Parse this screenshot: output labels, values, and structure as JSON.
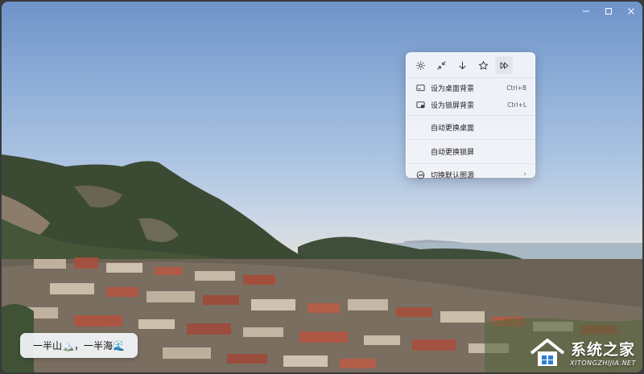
{
  "window_controls": {
    "minimize_icon": "minimize-icon",
    "maximize_icon": "maximize-icon",
    "close_icon": "close-icon"
  },
  "context_menu": {
    "toolbar": [
      {
        "name": "settings",
        "icon": "gear-icon"
      },
      {
        "name": "shrink",
        "icon": "collapse-icon"
      },
      {
        "name": "download",
        "icon": "download-icon"
      },
      {
        "name": "favorite",
        "icon": "star-icon"
      },
      {
        "name": "next",
        "icon": "fast-forward-icon"
      }
    ],
    "items": [
      {
        "label": "设为桌面背景",
        "shortcut": "Ctrl+B",
        "icon": "desktop-icon"
      },
      {
        "label": "设为锁屏背景",
        "shortcut": "Ctrl+L",
        "icon": "lock-screen-icon"
      },
      {
        "label": "自动更换桌面",
        "shortcut": ""
      },
      {
        "label": "自动更换锁屏",
        "shortcut": ""
      },
      {
        "label": "切换默认图源",
        "shortcut": "",
        "icon": "image-source-icon",
        "has_submenu": true
      }
    ]
  },
  "caption": {
    "text": "一半山🏔️，一半海🌊"
  },
  "watermark": {
    "main": "系统之家",
    "sub": "XITONGZHIJIA.NET"
  },
  "colors": {
    "sky_top": "#6e93c9",
    "sky_horizon": "#efe3d2",
    "menu_bg": "#f2f4f9",
    "sea": "#9fb2c0"
  }
}
